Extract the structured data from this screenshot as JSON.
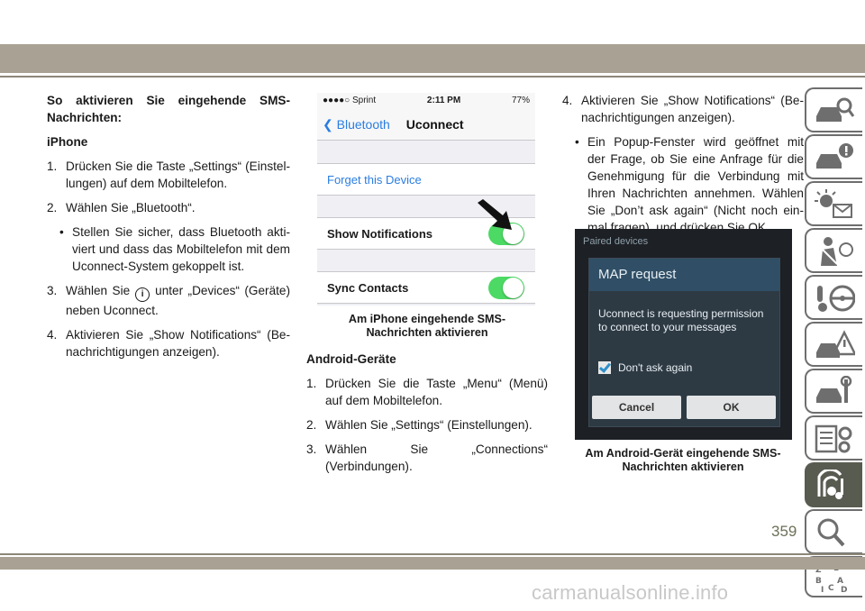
{
  "left": {
    "heading": "So aktivieren Sie eingehende SMS-Nachrichten:",
    "subheading": "iPhone",
    "steps": [
      {
        "n": "1.",
        "text": "Drücken Sie die Taste „Settings“ (Einstel-lungen) auf dem Mobiltelefon."
      },
      {
        "n": "2.",
        "text": "Wählen Sie „Bluetooth“."
      },
      {
        "n": "3.",
        "pre": "Wählen Sie",
        "post": "unter „Devices“ (Geräte) neben Uconnect."
      },
      {
        "n": "4.",
        "text": "Aktivieren Sie „Show Notifications“ (Be-nachrichtigungen anzeigen)."
      }
    ],
    "bullet": "Stellen Sie sicher, dass Bluetooth akti-viert und dass das Mobiltelefon mit dem Uconnect-System gekoppelt ist."
  },
  "iphone": {
    "carrier": "●●●●○ Sprint",
    "time": "2:11 PM",
    "battery": "77%",
    "back": "Bluetooth",
    "title": "Uconnect",
    "forget": "Forget this Device",
    "notifications": "Show Notifications",
    "sync": "Sync Contacts",
    "caption": "Am iPhone eingehende SMS-Nachrichten aktivieren"
  },
  "middle": {
    "subheading": "Android-Geräte",
    "steps": [
      {
        "n": "1.",
        "text": "Drücken Sie die Taste „Menu“ (Menü) auf dem Mobiltelefon."
      },
      {
        "n": "2.",
        "text": "Wählen Sie „Settings“ (Einstellungen)."
      },
      {
        "n": "3.",
        "text": "Wählen Sie „Connections“ (Verbindungen)."
      }
    ]
  },
  "right": {
    "step4": {
      "n": "4.",
      "text": "Aktivieren Sie „Show Notifications“ (Be-nachrichtigungen anzeigen)."
    },
    "bullet": "Ein Popup-Fenster wird geöffnet mit der Frage, ob Sie eine Anfrage für die Genehmigung für die Verbindung mit Ihren Nachrichten annehmen. Wählen Sie „Don’t ask again“ (Nicht noch ein-mal fragen), und drücken Sie OK."
  },
  "android": {
    "paired": "Paired devices",
    "title": "MAP request",
    "message": "Uconnect is requesting permission to connect to your messages",
    "checkbox": "Don't ask again",
    "cancel": "Cancel",
    "ok": "OK",
    "caption": "Am Android-Gerät eingehende SMS-Nachrichten aktivieren"
  },
  "page_number": "359",
  "watermark": "carmanualsonline.info",
  "tabs": [
    {
      "icon": "car-magnifier-icon"
    },
    {
      "icon": "car-info-icon"
    },
    {
      "icon": "warning-light-message-icon"
    },
    {
      "icon": "seatbelt-airbag-icon"
    },
    {
      "icon": "steering-wheel-icon"
    },
    {
      "icon": "car-warning-triangle-icon"
    },
    {
      "icon": "car-wrench-icon"
    },
    {
      "icon": "checklist-gear-icon"
    },
    {
      "icon": "multimedia-icon"
    },
    {
      "icon": "search-icon"
    },
    {
      "icon": "index-icon"
    }
  ]
}
